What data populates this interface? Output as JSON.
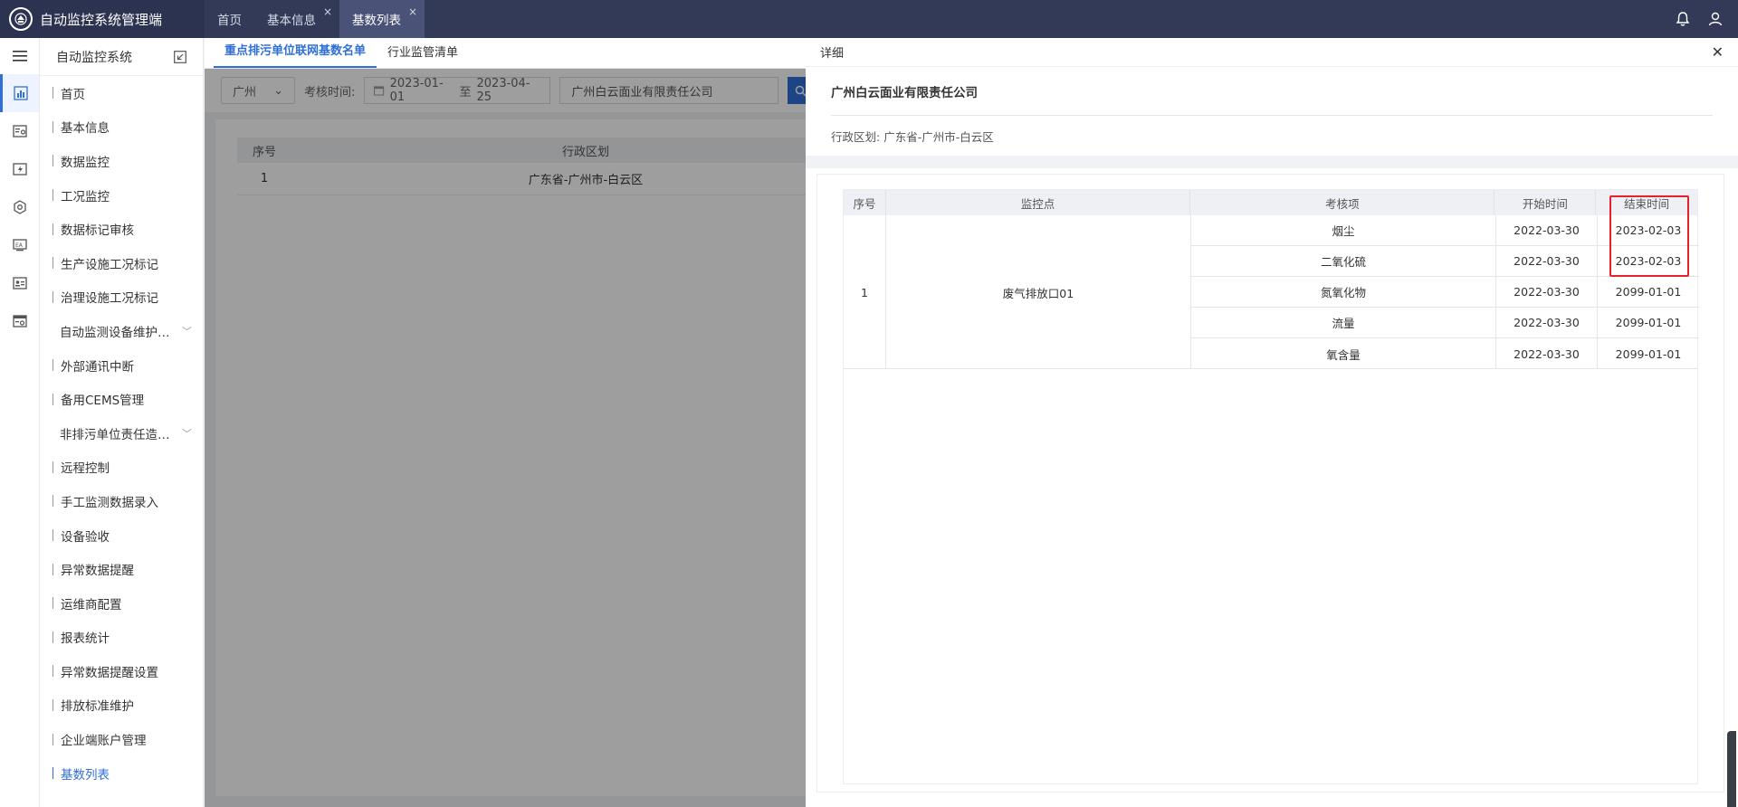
{
  "app": {
    "title": "自动监控系统管理端"
  },
  "tabs": [
    {
      "label": "首页",
      "closable": false,
      "active": false
    },
    {
      "label": "基本信息",
      "closable": true,
      "active": false
    },
    {
      "label": "基数列表",
      "closable": true,
      "active": true
    }
  ],
  "tab_close_glyph": "×",
  "sidebar": {
    "title": "自动监控系统",
    "items": [
      {
        "label": "首页"
      },
      {
        "label": "基本信息"
      },
      {
        "label": "数据监控"
      },
      {
        "label": "工况监控"
      },
      {
        "label": "数据标记审核"
      },
      {
        "label": "生产设施工况标记"
      },
      {
        "label": "治理设施工况标记"
      },
      {
        "label": "自动监测设备维护…",
        "group": true
      },
      {
        "label": "外部通讯中断"
      },
      {
        "label": "备用CEMS管理"
      },
      {
        "label": "非排污单位责任造…",
        "group": true
      },
      {
        "label": "远程控制"
      },
      {
        "label": "手工监测数据录入"
      },
      {
        "label": "设备验收"
      },
      {
        "label": "异常数据提醒"
      },
      {
        "label": "运维商配置"
      },
      {
        "label": "报表统计"
      },
      {
        "label": "异常数据提醒设置"
      },
      {
        "label": "排放标准维护"
      },
      {
        "label": "企业端账户管理"
      },
      {
        "label": "基数列表",
        "active": true
      }
    ]
  },
  "main": {
    "subtabs": [
      "重点排污单位联网基数名单",
      "行业监管清单"
    ],
    "filter": {
      "city": "广州",
      "period_label": "考核时间:",
      "date_from": "2023-01-01",
      "date_sep": "至",
      "date_to": "2023-04-25",
      "company": "广州白云面业有限责任公司"
    },
    "table": {
      "headers": [
        "序号",
        "行政区划"
      ],
      "rows": [
        {
          "seq": "1",
          "region": "广东省-广州市-白云区"
        }
      ]
    }
  },
  "drawer": {
    "title": "详细",
    "close_glyph": "✕",
    "company": "广州白云面业有限责任公司",
    "region_label": "行政区划:",
    "region_value": "广东省-广州市-白云区",
    "headers": [
      "序号",
      "监控点",
      "考核项",
      "开始时间",
      "结束时间"
    ],
    "group": {
      "seq": "1",
      "point": "废气排放口01",
      "rows": [
        {
          "item": "烟尘",
          "start": "2022-03-30",
          "end": "2023-02-03"
        },
        {
          "item": "二氧化硫",
          "start": "2022-03-30",
          "end": "2023-02-03"
        },
        {
          "item": "氮氧化物",
          "start": "2022-03-30",
          "end": "2099-01-01"
        },
        {
          "item": "流量",
          "start": "2022-03-30",
          "end": "2099-01-01"
        },
        {
          "item": "氧含量",
          "start": "2022-03-30",
          "end": "2099-01-01"
        }
      ]
    }
  },
  "colors": {
    "topbar": "#323a57",
    "accent": "#2f6fd6",
    "highlight": "#e8202a"
  }
}
